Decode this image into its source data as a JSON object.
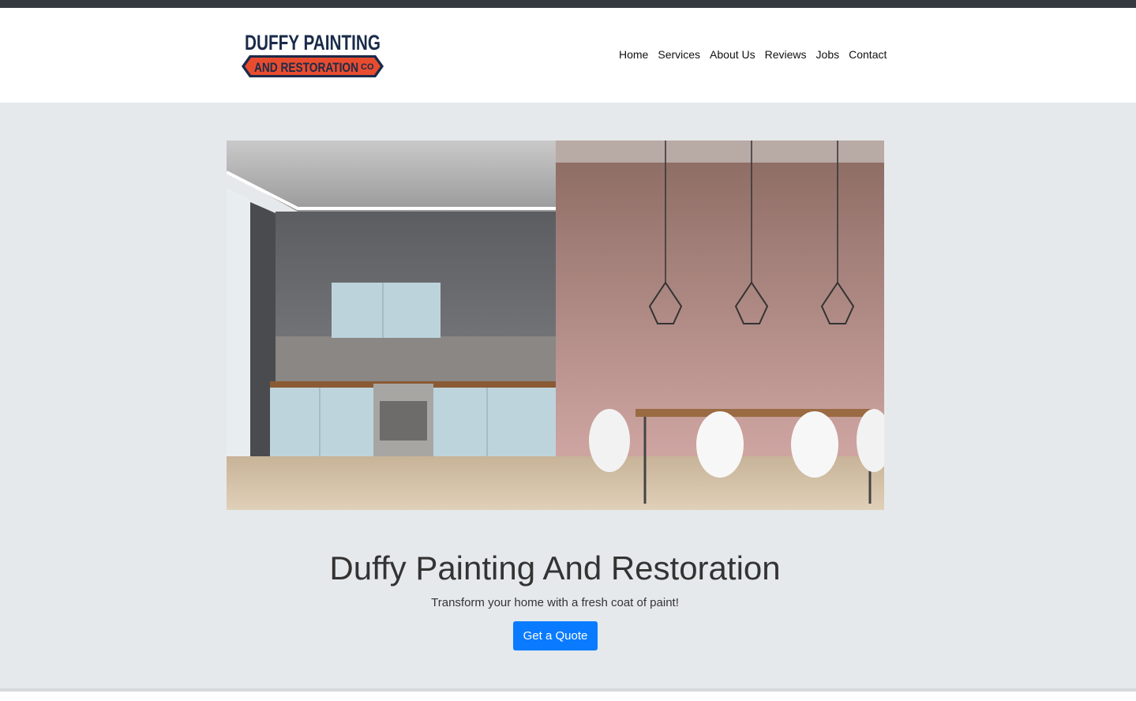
{
  "logo": {
    "line1": "DUFFY PAINTING",
    "line2": "AND RESTORATION",
    "suffix": "CO",
    "colors": {
      "navy": "#1a2b4a",
      "red": "#e84c2f"
    }
  },
  "nav": {
    "items": [
      {
        "label": "Home"
      },
      {
        "label": "Services"
      },
      {
        "label": "About Us"
      },
      {
        "label": "Reviews"
      },
      {
        "label": "Jobs"
      },
      {
        "label": "Contact"
      }
    ]
  },
  "hero": {
    "image_icon": "kitchen-dining-photo",
    "title": "Duffy Painting And Restoration",
    "subtitle": "Transform your home with a fresh coat of paint!",
    "cta_label": "Get a Quote"
  },
  "colors": {
    "topbar": "#343a40",
    "hero_bg": "#e6e9ec",
    "accent": "#0a7bff"
  }
}
